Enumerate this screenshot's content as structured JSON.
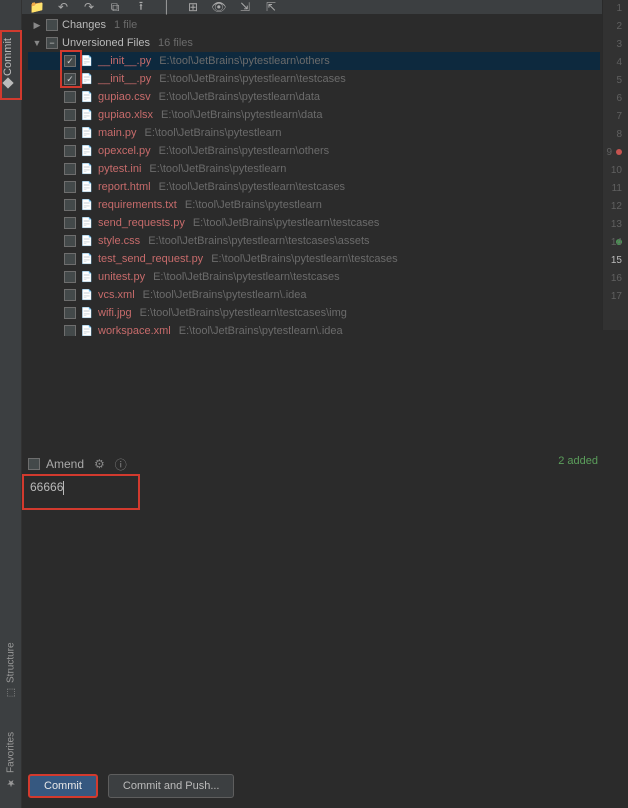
{
  "toolbar_icons": [
    "folder",
    "undo",
    "redo",
    "diff",
    "upload",
    "sep",
    "group",
    "eye",
    "collapse",
    "expand"
  ],
  "commit_tab_label": "Commit",
  "side_tabs": {
    "structure": "Structure",
    "favorites": "Favorites"
  },
  "tree": {
    "changes": {
      "label": "Changes",
      "count": "1 file"
    },
    "unversioned": {
      "label": "Unversioned Files",
      "count": "16 files"
    },
    "files": [
      {
        "checked": true,
        "selected": true,
        "name": "__init__.py",
        "path": "E:\\tool\\JetBrains\\pytestlearn\\others"
      },
      {
        "checked": true,
        "selected": false,
        "name": "__init__.py",
        "path": "E:\\tool\\JetBrains\\pytestlearn\\testcases"
      },
      {
        "checked": false,
        "selected": false,
        "name": "gupiao.csv",
        "path": "E:\\tool\\JetBrains\\pytestlearn\\data"
      },
      {
        "checked": false,
        "selected": false,
        "name": "gupiao.xlsx",
        "path": "E:\\tool\\JetBrains\\pytestlearn\\data"
      },
      {
        "checked": false,
        "selected": false,
        "name": "main.py",
        "path": "E:\\tool\\JetBrains\\pytestlearn"
      },
      {
        "checked": false,
        "selected": false,
        "name": "opexcel.py",
        "path": "E:\\tool\\JetBrains\\pytestlearn\\others"
      },
      {
        "checked": false,
        "selected": false,
        "name": "pytest.ini",
        "path": "E:\\tool\\JetBrains\\pytestlearn"
      },
      {
        "checked": false,
        "selected": false,
        "name": "report.html",
        "path": "E:\\tool\\JetBrains\\pytestlearn\\testcases"
      },
      {
        "checked": false,
        "selected": false,
        "name": "requirements.txt",
        "path": "E:\\tool\\JetBrains\\pytestlearn"
      },
      {
        "checked": false,
        "selected": false,
        "name": "send_requests.py",
        "path": "E:\\tool\\JetBrains\\pytestlearn\\testcases"
      },
      {
        "checked": false,
        "selected": false,
        "name": "style.css",
        "path": "E:\\tool\\JetBrains\\pytestlearn\\testcases\\assets"
      },
      {
        "checked": false,
        "selected": false,
        "name": "test_send_request.py",
        "path": "E:\\tool\\JetBrains\\pytestlearn\\testcases"
      },
      {
        "checked": false,
        "selected": false,
        "name": "unitest.py",
        "path": "E:\\tool\\JetBrains\\pytestlearn\\testcases"
      },
      {
        "checked": false,
        "selected": false,
        "name": "vcs.xml",
        "path": "E:\\tool\\JetBrains\\pytestlearn\\.idea"
      },
      {
        "checked": false,
        "selected": false,
        "name": "wifi.jpg",
        "path": "E:\\tool\\JetBrains\\pytestlearn\\testcases\\img"
      },
      {
        "checked": false,
        "selected": false,
        "name": "workspace.xml",
        "path": "E:\\tool\\JetBrains\\pytestlearn\\.idea"
      }
    ]
  },
  "amend_label": "Amend",
  "added_label": "2 added",
  "commit_message": "66666",
  "buttons": {
    "commit": "Commit",
    "commit_push": "Commit and Push..."
  },
  "line_numbers": [
    "1",
    "2",
    "3",
    "4",
    "5",
    "6",
    "7",
    "8",
    "9",
    "10",
    "11",
    "12",
    "13",
    "14",
    "15",
    "16",
    "17"
  ]
}
